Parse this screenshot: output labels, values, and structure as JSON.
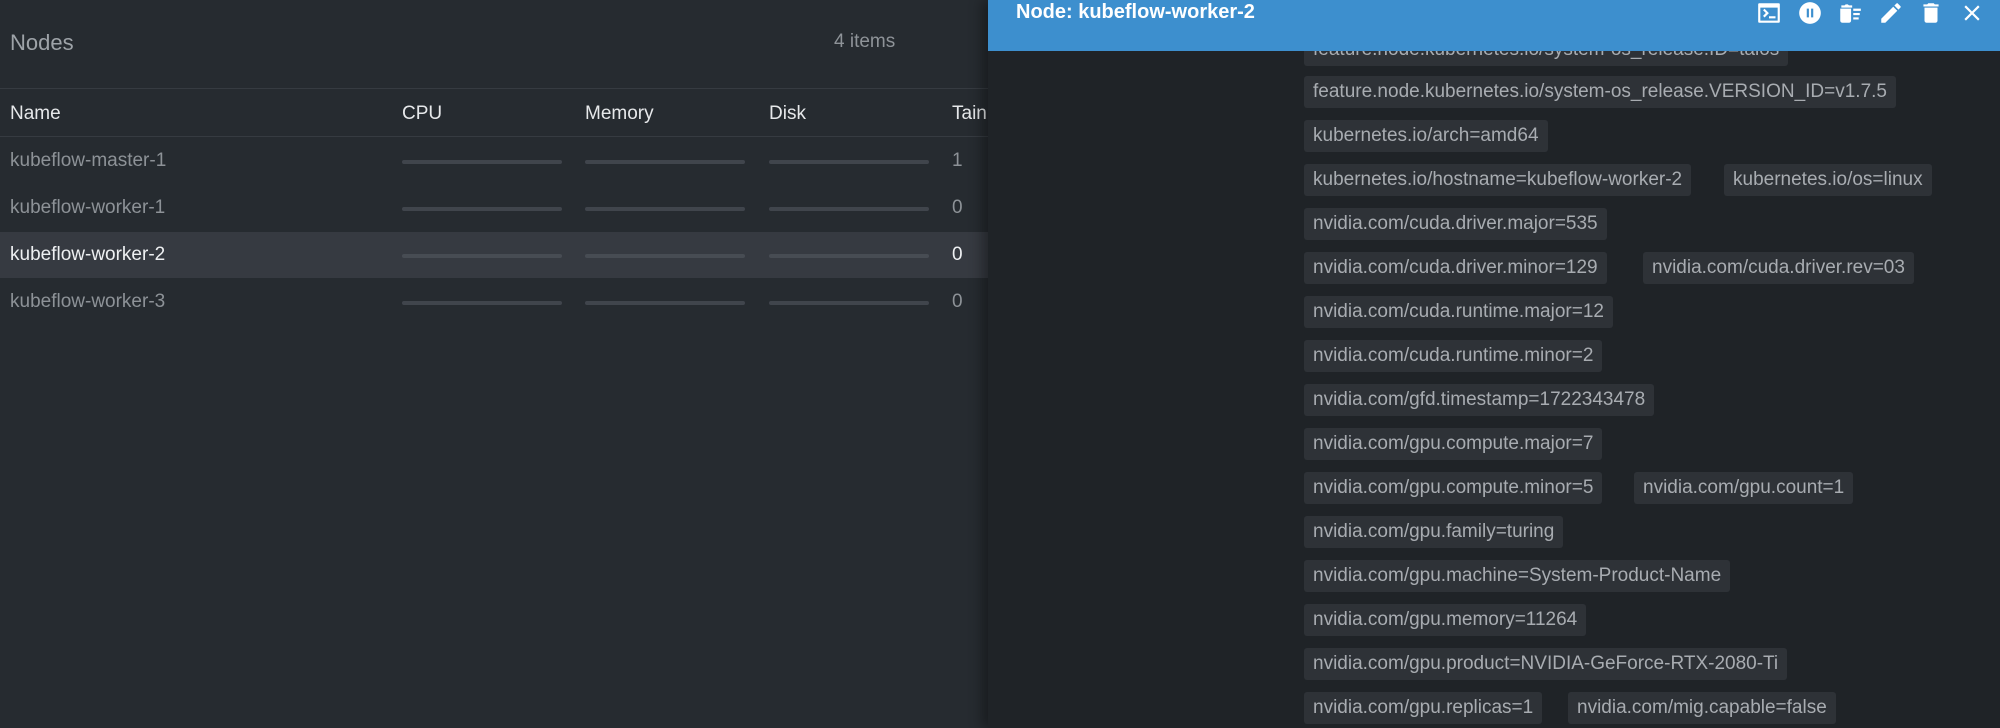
{
  "list": {
    "title": "Nodes",
    "count": "4 items",
    "columns": {
      "name": "Name",
      "cpu": "CPU",
      "memory": "Memory",
      "disk": "Disk",
      "taints": "Tain"
    },
    "rows": [
      {
        "name": "kubeflow-master-1",
        "taints": "1"
      },
      {
        "name": "kubeflow-worker-1",
        "taints": "0"
      },
      {
        "name": "kubeflow-worker-2",
        "taints": "0",
        "selected": true
      },
      {
        "name": "kubeflow-worker-3",
        "taints": "0"
      }
    ]
  },
  "drawer": {
    "title": "Node: kubeflow-worker-2",
    "toolbar": {
      "shell": "terminal-icon",
      "cordon": "pause-circle-icon",
      "drain": "drain-icon",
      "edit": "pencil-icon",
      "remove": "trash-icon",
      "close": "close-icon"
    },
    "labels": [
      "feature.node.kubernetes.io/system-os_release.ID=talos",
      "feature.node.kubernetes.io/system-os_release.VERSION_ID=v1.7.5",
      "kubernetes.io/arch=amd64",
      "kubernetes.io/hostname=kubeflow-worker-2",
      "kubernetes.io/os=linux",
      "nvidia.com/cuda.driver.major=535",
      "nvidia.com/cuda.driver.minor=129",
      "nvidia.com/cuda.driver.rev=03",
      "nvidia.com/cuda.runtime.major=12",
      "nvidia.com/cuda.runtime.minor=2",
      "nvidia.com/gfd.timestamp=1722343478",
      "nvidia.com/gpu.compute.major=7",
      "nvidia.com/gpu.compute.minor=5",
      "nvidia.com/gpu.count=1",
      "nvidia.com/gpu.family=turing",
      "nvidia.com/gpu.machine=System-Product-Name",
      "nvidia.com/gpu.memory=11264",
      "nvidia.com/gpu.product=NVIDIA-GeForce-RTX-2080-Ti",
      "nvidia.com/gpu.replicas=1",
      "nvidia.com/mig.capable=false"
    ]
  },
  "colors": {
    "accent": "#3d8fce",
    "background": "#262b30",
    "drawer_bg": "#1f2327",
    "chip_bg": "#2e3237"
  }
}
